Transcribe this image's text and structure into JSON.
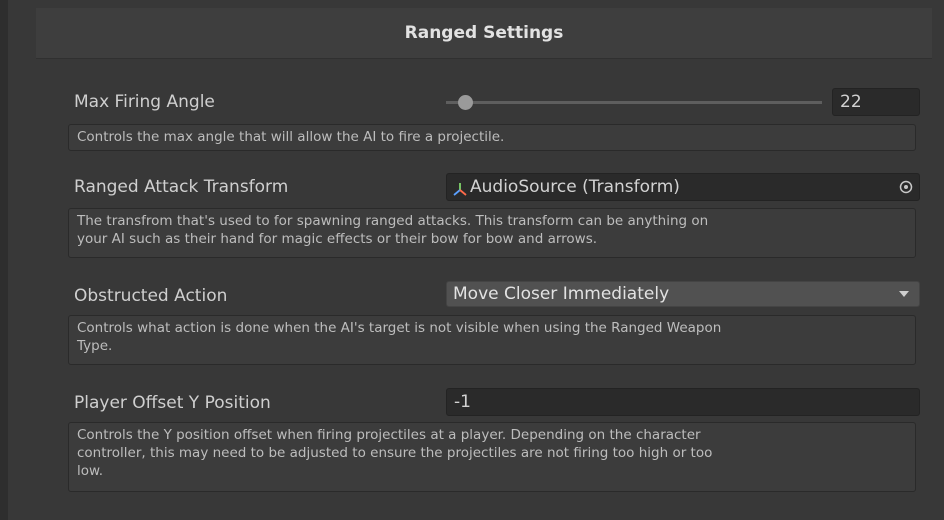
{
  "header": {
    "title": "Ranged Settings"
  },
  "max_firing_angle": {
    "label": "Max Firing Angle",
    "value": "22",
    "slider_fraction": 0.05,
    "help": "Controls the max angle that will allow the AI to fire a projectile."
  },
  "ranged_attack_transform": {
    "label": "Ranged Attack Transform",
    "value": "AudioSource (Transform)",
    "icon": "transform-axes-icon",
    "help_line1": "The transfrom that's used to for spawning ranged attacks. This transform can be anything on",
    "help_line2": "your AI such as their hand for magic effects or their bow for bow and arrows."
  },
  "obstructed_action": {
    "label": "Obstructed Action",
    "selected": "Move Closer Immediately",
    "help_line1": "Controls what action is done when the AI's target is not visible when using the Ranged Weapon",
    "help_line2": "Type."
  },
  "player_offset_y": {
    "label": "Player Offset Y Position",
    "value": "-1",
    "help_line1": "Controls the Y position offset when firing projectiles at a player. Depending on the character",
    "help_line2": "controller, this may need to be adjusted to ensure the projectiles are not firing too high or too",
    "help_line3": "low."
  }
}
